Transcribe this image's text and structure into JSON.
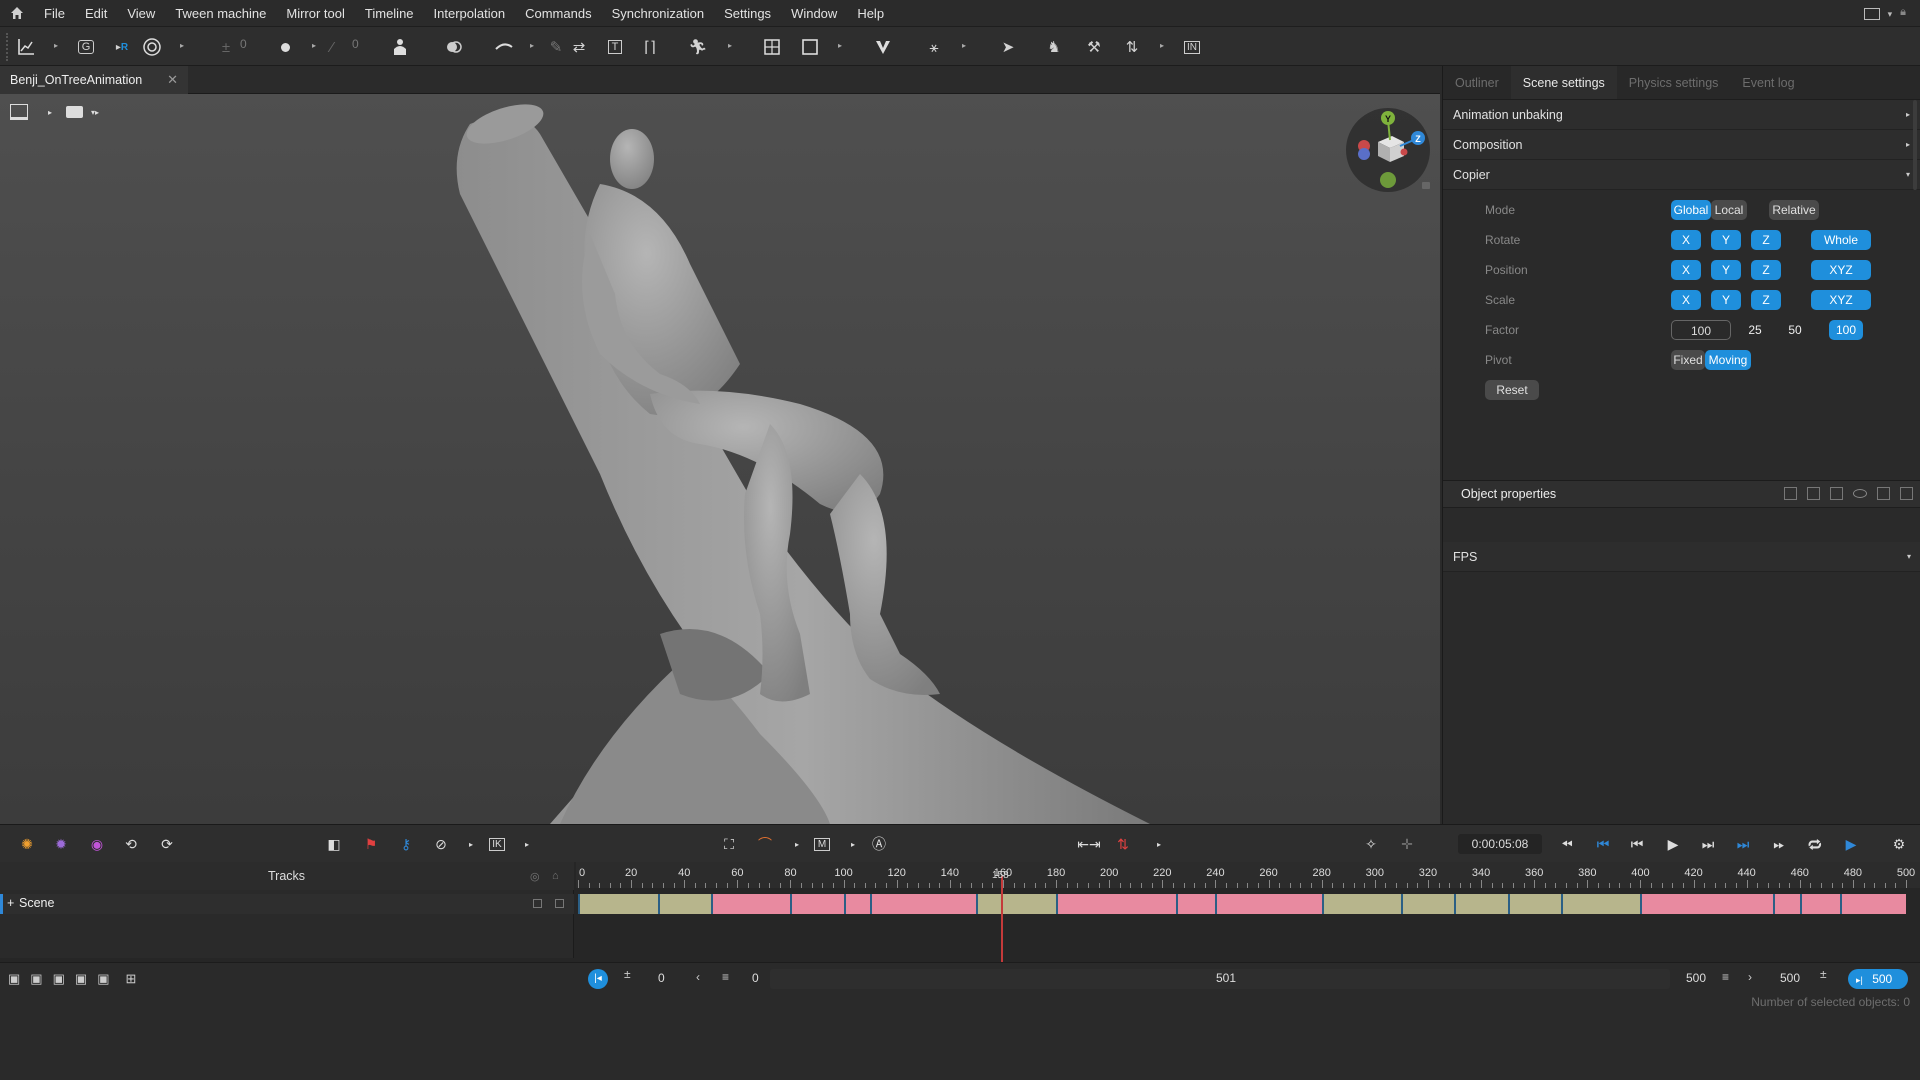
{
  "menu": [
    "File",
    "Edit",
    "View",
    "Tween machine",
    "Mirror tool",
    "Timeline",
    "Interpolation",
    "Commands",
    "Synchronization",
    "Settings",
    "Window",
    "Help"
  ],
  "toolbar": {
    "num_a": "0",
    "num_b": "0",
    "ik_label": "IN"
  },
  "document_tab": {
    "title": "Benji_OnTreeAnimation"
  },
  "right_tabs": [
    "Outliner",
    "Scene settings",
    "Physics settings",
    "Event log"
  ],
  "sections": {
    "anim_unbaking": "Animation unbaking",
    "composition": "Composition",
    "copier": "Copier",
    "fps": "FPS"
  },
  "copier": {
    "mode_label": "Mode",
    "mode_global": "Global",
    "mode_local": "Local",
    "mode_relative": "Relative",
    "rotate_label": "Rotate",
    "position_label": "Position",
    "scale_label": "Scale",
    "x": "X",
    "y": "Y",
    "z": "Z",
    "whole": "Whole",
    "xyz": "XYZ",
    "factor_label": "Factor",
    "factor_value": "100",
    "f25": "25",
    "f50": "50",
    "f100": "100",
    "pivot_label": "Pivot",
    "pivot_fixed": "Fixed",
    "pivot_moving": "Moving",
    "reset": "Reset"
  },
  "object_properties": {
    "title": "Object properties"
  },
  "gizmo": {
    "y": "Y",
    "z": "Z"
  },
  "timeline": {
    "timecode": "0:00:05:08",
    "ik": "IK",
    "m": "M",
    "tracks_label": "Tracks",
    "scene_label": "Scene",
    "current_frame": "158",
    "ruler": [
      "0",
      "20",
      "40",
      "60",
      "80",
      "100",
      "120",
      "140",
      "160",
      "180",
      "200",
      "220",
      "240",
      "260",
      "280",
      "300",
      "320",
      "340",
      "360",
      "380",
      "400",
      "420",
      "440",
      "460",
      "480",
      "500"
    ]
  },
  "range": {
    "start": "0",
    "start2": "0",
    "mid": "501",
    "end1": "500",
    "end2": "500",
    "end3": "500"
  },
  "status": {
    "selected": "Number of selected objects: 0"
  }
}
